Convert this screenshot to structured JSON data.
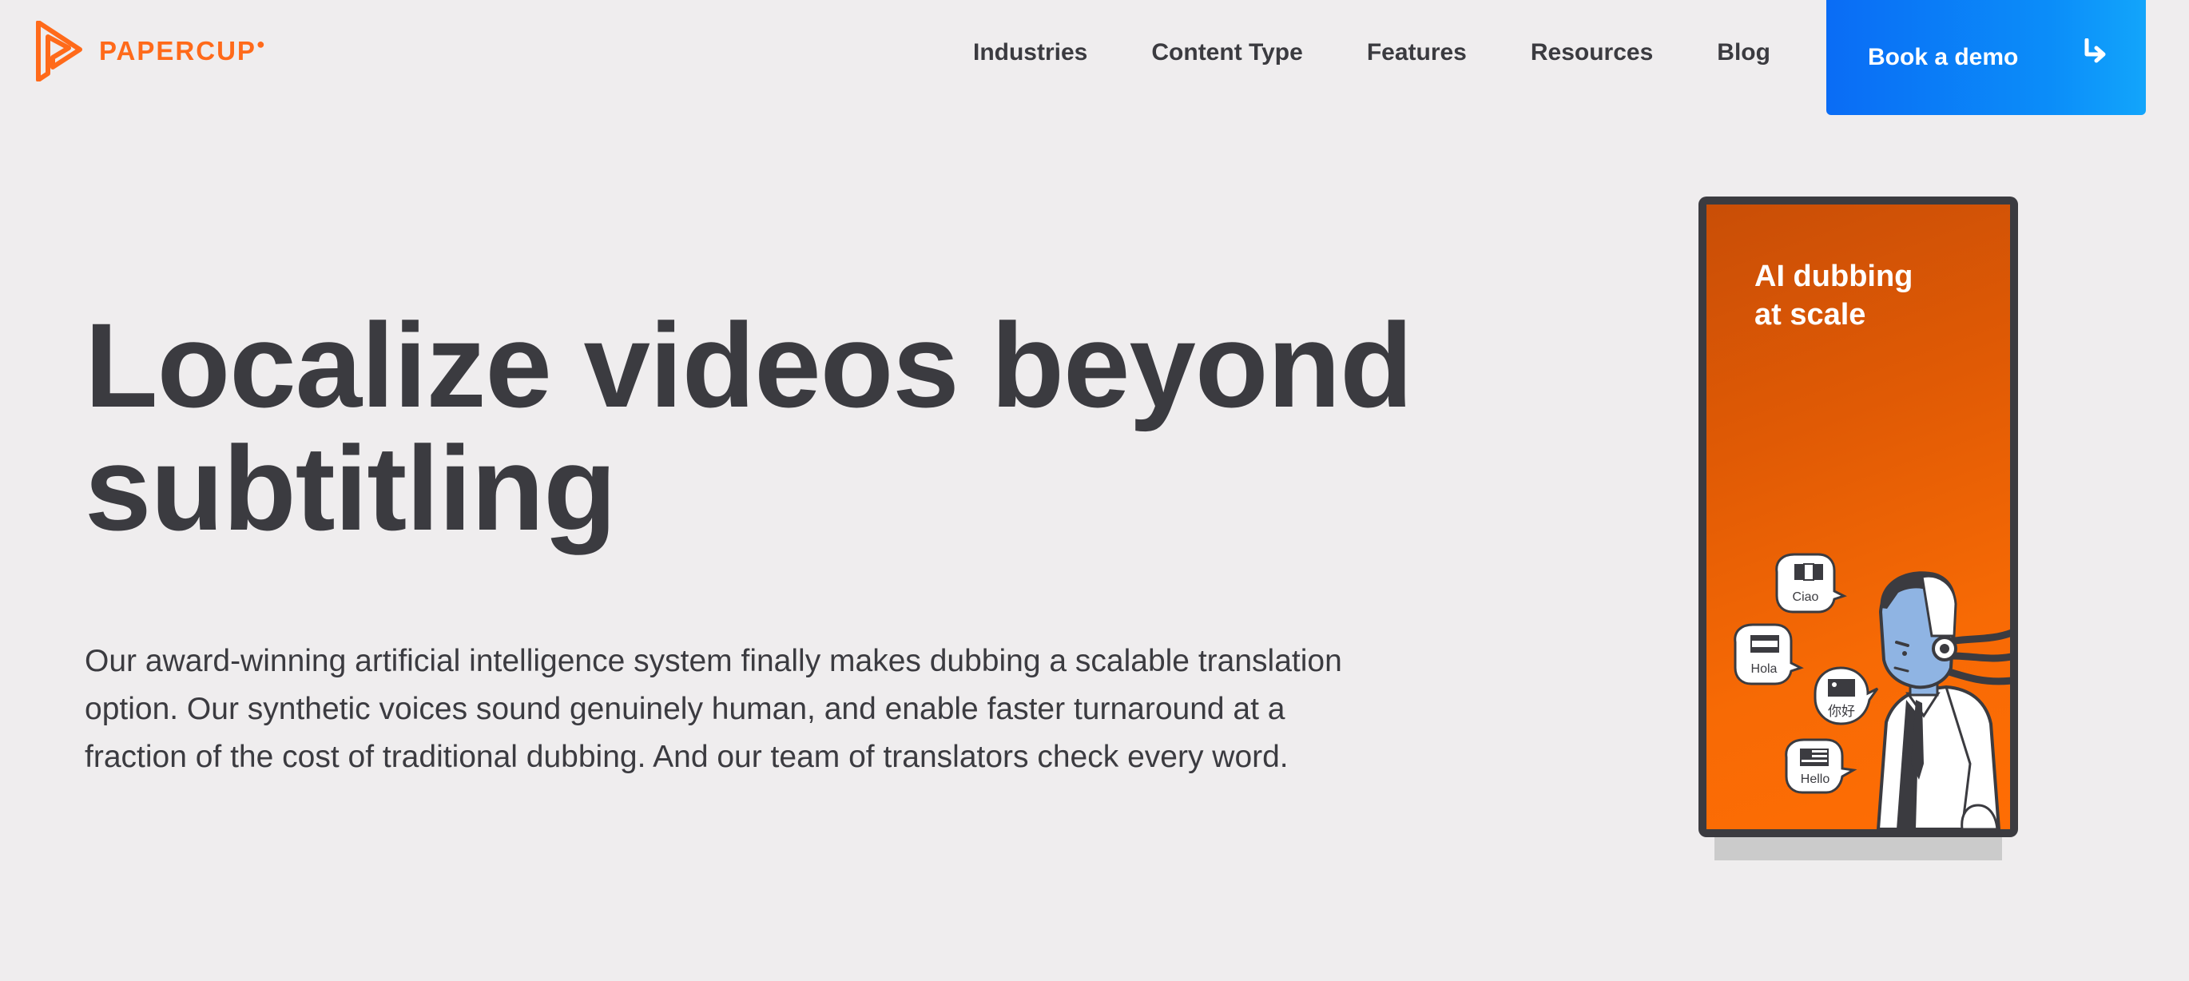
{
  "brand": {
    "name": "PAPERCUP",
    "color": "#ff6a1a",
    "logo_icon": "papercup-logo-icon"
  },
  "nav": {
    "items": [
      {
        "label": "Industries"
      },
      {
        "label": "Content Type"
      },
      {
        "label": "Features"
      },
      {
        "label": "Resources"
      },
      {
        "label": "Blog"
      }
    ],
    "cta": {
      "label": "Book a demo",
      "icon": "arrow-turn-down-right-icon",
      "color": "#0a6cf5"
    }
  },
  "hero": {
    "title_line1": "Localize videos beyond",
    "title_line2": "subtitling",
    "body": "Our award-winning artificial intelligence system finally makes dubbing a scalable translation option. Our synthetic voices sound genuinely human, and enable faster turnaround at a fraction of the cost of traditional dubbing. And our team of translators check every word."
  },
  "phone_card": {
    "caption_line1": "AI dubbing",
    "caption_line2": "at scale",
    "bubbles": [
      {
        "label": "Ciao",
        "icon": "italy-flag-icon"
      },
      {
        "label": "Hola",
        "icon": "spain-flag-icon"
      },
      {
        "label": "你好",
        "icon": "china-flag-icon"
      },
      {
        "label": "Hello",
        "icon": "us-flag-icon"
      }
    ],
    "background_color": "#f76a05",
    "robot_icon": "robot-presenter-illustration"
  }
}
